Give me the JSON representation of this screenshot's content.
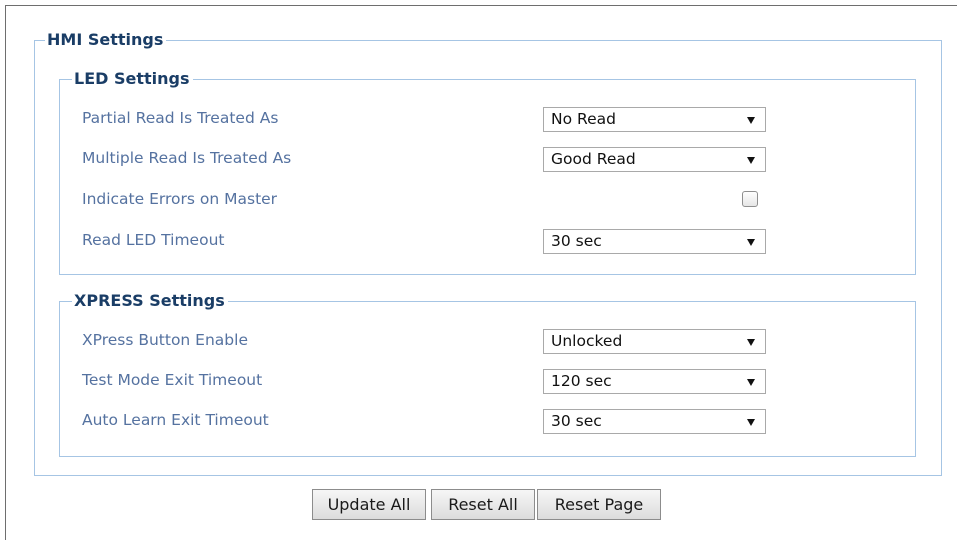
{
  "hmi": {
    "legend": "HMI Settings"
  },
  "led": {
    "legend": "LED Settings",
    "partial_read": {
      "label": "Partial Read Is Treated As",
      "value": "No Read"
    },
    "multiple_read": {
      "label": "Multiple Read Is Treated As",
      "value": "Good Read"
    },
    "indicate_errors": {
      "label": "Indicate Errors on Master",
      "checked": false
    },
    "read_led_timeout": {
      "label": "Read LED Timeout",
      "value": "30 sec"
    }
  },
  "xpress": {
    "legend": "XPRESS Settings",
    "button_enable": {
      "label": "XPress Button Enable",
      "value": "Unlocked"
    },
    "test_mode_exit": {
      "label": "Test Mode Exit Timeout",
      "value": "120 sec"
    },
    "auto_learn_exit": {
      "label": "Auto Learn Exit Timeout",
      "value": "30 sec"
    }
  },
  "buttons": {
    "update_all": "Update All",
    "reset_all": "Reset All",
    "reset_page": "Reset Page"
  }
}
